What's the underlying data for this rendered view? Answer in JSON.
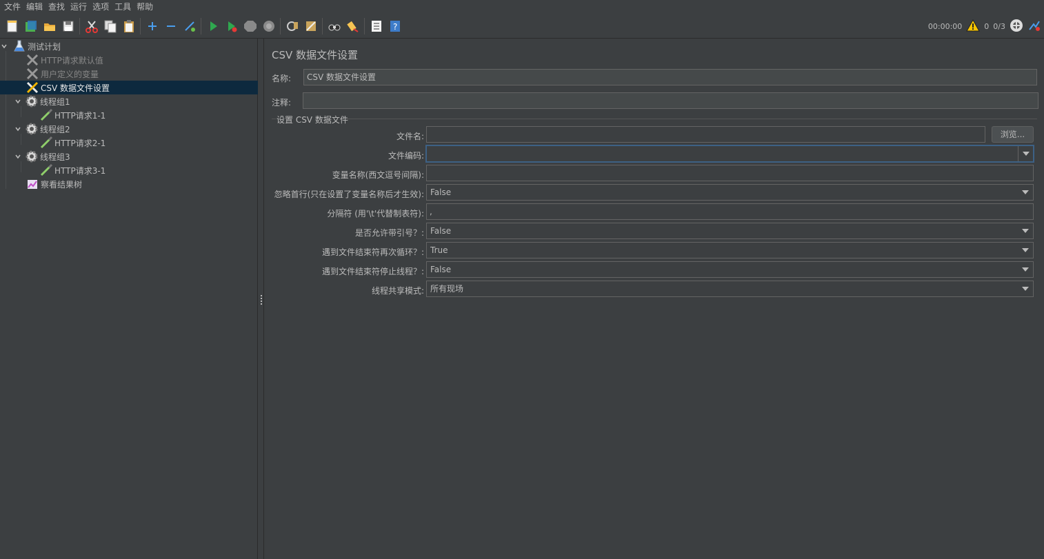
{
  "menu": [
    "文件",
    "编辑",
    "查找",
    "运行",
    "选项",
    "工具",
    "帮助"
  ],
  "toolbar": {
    "timer": "00:00:00",
    "warning_count": "0",
    "threads": "0/3",
    "icons": [
      "new-icon",
      "templates-icon",
      "open-icon",
      "save-icon",
      "cut-icon",
      "copy-icon",
      "paste-icon",
      "expand-icon",
      "collapse-icon",
      "toggle-icon",
      "start-icon",
      "start-no-pause-icon",
      "stop-icon",
      "shutdown-icon",
      "clear-icon",
      "clear-all-icon",
      "search-icon",
      "reset-search-icon",
      "function-helper-icon",
      "help-icon"
    ]
  },
  "tree": {
    "items": [
      {
        "label": "测试计划",
        "icon": "flask-icon"
      },
      {
        "label": "HTTP请求默认值",
        "icon": "wrench-icon"
      },
      {
        "label": "用户定义的变量",
        "icon": "wrench-icon"
      },
      {
        "label": "CSV 数据文件设置",
        "icon": "wrench-icon"
      },
      {
        "label": "线程组1",
        "icon": "gear-icon"
      },
      {
        "label": "HTTP请求1-1",
        "icon": "pipette-icon"
      },
      {
        "label": "线程组2",
        "icon": "gear-icon"
      },
      {
        "label": "HTTP请求2-1",
        "icon": "pipette-icon"
      },
      {
        "label": "线程组3",
        "icon": "gear-icon"
      },
      {
        "label": "HTTP请求3-1",
        "icon": "pipette-icon"
      },
      {
        "label": "察看结果树",
        "icon": "chart-icon"
      }
    ]
  },
  "panel": {
    "title": "CSV 数据文件设置",
    "name_label": "名称:",
    "name_value": "CSV 数据文件设置",
    "comment_label": "注释:",
    "comment_value": "",
    "group_title": "设置 CSV 数据文件",
    "filename_label": "文件名:",
    "filename_value": "",
    "browse_label": "浏览...",
    "encoding_label": "文件编码:",
    "encoding_value": "",
    "varnames_label": "变量名称(西文逗号间隔):",
    "varnames_value": "",
    "ignore_first_label": "忽略首行(只在设置了变量名称后才生效):",
    "ignore_first_value": "False",
    "delimiter_label": "分隔符 (用'\\t'代替制表符):",
    "delimiter_value": ",",
    "quoted_label": "是否允许带引号？:",
    "quoted_value": "False",
    "recycle_label": "遇到文件结束符再次循环？:",
    "recycle_value": "True",
    "stop_thread_label": "遇到文件结束符停止线程？:",
    "stop_thread_value": "False",
    "sharing_label": "线程共享模式:",
    "sharing_value": "所有现场"
  }
}
